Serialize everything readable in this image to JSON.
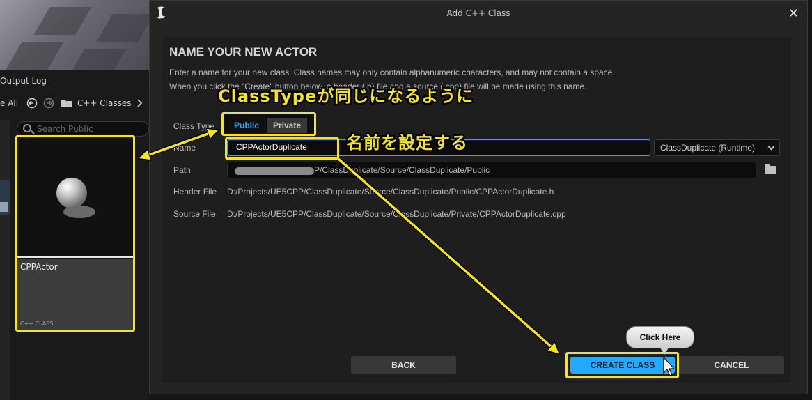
{
  "left": {
    "output_log": "Output Log",
    "save_all": "e All",
    "breadcrumb": "C++ Classes",
    "search_placeholder": "Search Public",
    "asset": {
      "name": "CPPActor",
      "kind": "C++ CLASS"
    }
  },
  "dialog": {
    "title": "Add C++ Class",
    "heading": "NAME YOUR NEW ACTOR",
    "desc1": "Enter a name for your new class. Class names may only contain alphanumeric characters, and may not contain a space.",
    "desc2": "When you click the \"Create\" button below, a header (.h) file and a source (.cpp) file will be made using this name.",
    "labels": {
      "class_type": "Class Type",
      "name": "Name",
      "path": "Path",
      "header_file": "Header File",
      "source_file": "Source File"
    },
    "class_type": {
      "public": "Public",
      "private": "Private",
      "selected": "Public"
    },
    "name_value": "CPPActorDuplicate",
    "module": "ClassDuplicate (Runtime)",
    "path_value": "P/ClassDuplicate/Source/ClassDuplicate/Public",
    "header_value": "D:/Projects/UE5CPP/ClassDuplicate/Source/ClassDuplicate/Public/CPPActorDuplicate.h",
    "source_value": "D:/Projects/UE5CPP/ClassDuplicate/Source/ClassDuplicate/Private/CPPActorDuplicate.cpp",
    "buttons": {
      "back": "BACK",
      "create": "CREATE CLASS",
      "cancel": "CANCEL"
    }
  },
  "annotations": {
    "class_type_note": "ClassTypeが同じになるように",
    "name_note": "名前を設定する",
    "click_here": "Click Here"
  },
  "colors": {
    "accent": "#22aaff",
    "highlight": "#f5e51a"
  }
}
